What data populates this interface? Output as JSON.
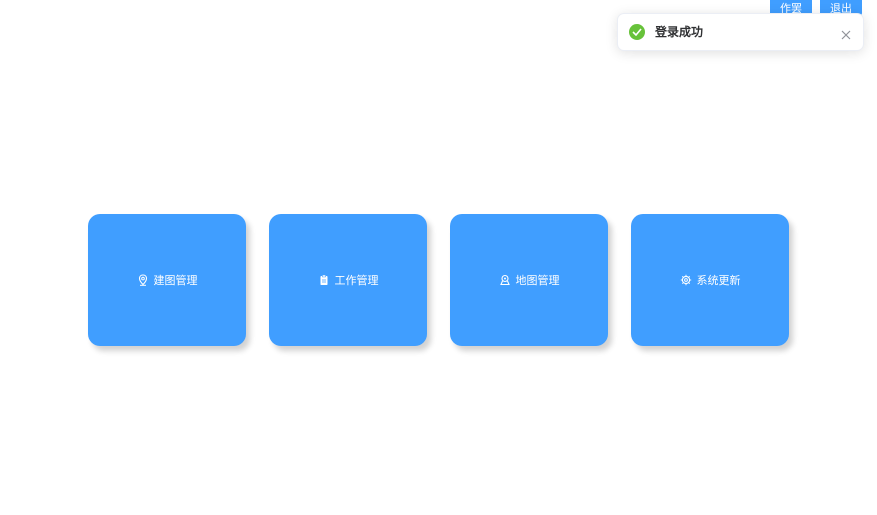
{
  "header": {
    "user_button_label": "作罢",
    "logout_button_label": "退出"
  },
  "notification": {
    "type": "success",
    "message": "登录成功",
    "close_icon": "close-icon",
    "status_icon": "check-circle-icon"
  },
  "tiles": [
    {
      "label": "建图管理",
      "icon": "location-pin-icon"
    },
    {
      "label": "工作管理",
      "icon": "clipboard-icon"
    },
    {
      "label": "地图管理",
      "icon": "map-location-icon"
    },
    {
      "label": "系统更新",
      "icon": "settings-gear-icon"
    }
  ],
  "colors": {
    "primary": "#409eff",
    "success": "#67c23a"
  }
}
